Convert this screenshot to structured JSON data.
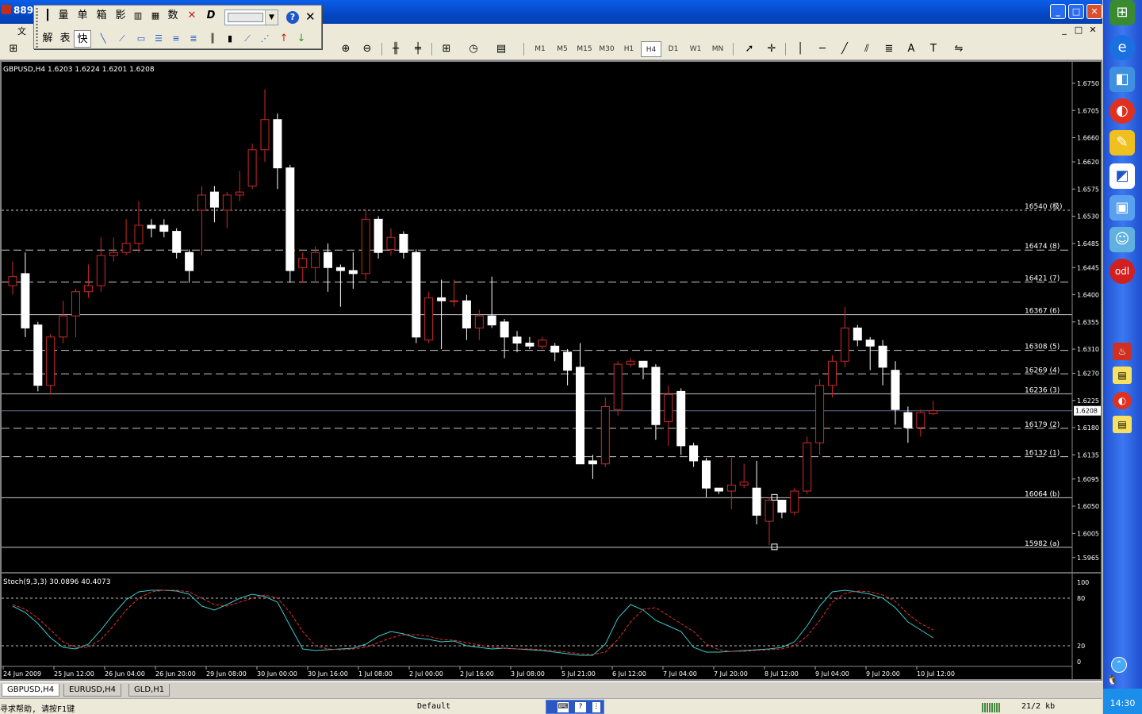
{
  "window": {
    "title": "889",
    "btn_min": "_",
    "btn_max": "□",
    "btn_close": "✕"
  },
  "menubar": {
    "items": [
      "文"
    ],
    "mdi_min": "_",
    "mdi_max": "□",
    "mdi_close": "✕"
  },
  "floatbar": {
    "row1": [
      "量",
      "单",
      "箱",
      "影",
      "数"
    ],
    "row2": [
      "解",
      "表",
      "快"
    ],
    "help": "?",
    "close": "✕"
  },
  "timeframes": [
    "M1",
    "M5",
    "M15",
    "M30",
    "H1",
    "H4",
    "D1",
    "W1",
    "MN"
  ],
  "active_timeframe": "H4",
  "toolbar_text_tool": "A",
  "chart": {
    "header": "GBPUSD,H4  1.6203 1.6224 1.6201 1.6208",
    "current_price": "1.6208",
    "indicator_label": "Stoch(9,3,3) 30.0896 40.4073",
    "osc_ticks": [
      "100",
      "80",
      "20",
      "0"
    ]
  },
  "chart_data": {
    "type": "candlestick",
    "title": "GBPUSD,H4  1.6203 1.6224 1.6201 1.6208",
    "y_ticks": [
      1.675,
      1.6705,
      1.666,
      1.662,
      1.6575,
      1.653,
      1.6485,
      1.6445,
      1.64,
      1.6355,
      1.631,
      1.627,
      1.6225,
      1.618,
      1.6135,
      1.6095,
      1.605,
      1.6005,
      1.5965
    ],
    "ylim": [
      1.5945,
      1.6775
    ],
    "x_ticks": [
      "24 Jun 2009",
      "25 Jun 12:00",
      "26 Jun 04:00",
      "26 Jun 20:00",
      "29 Jun 08:00",
      "30 Jun 00:00",
      "30 Jun 16:00",
      "1 Jul 08:00",
      "2 Jul 00:00",
      "2 Jul 16:00",
      "3 Jul 08:00",
      "5 Jul 21:00",
      "6 Jul 12:00",
      "7 Jul 04:00",
      "7 Jul 20:00",
      "8 Jul 12:00",
      "9 Jul 04:00",
      "9 Jul 20:00",
      "10 Jul 12:00"
    ],
    "levels": [
      {
        "label": "16540 (极)",
        "value": 1.654,
        "style": "dotted"
      },
      {
        "label": "16474 (8)",
        "value": 1.6474,
        "style": "dashed"
      },
      {
        "label": "16421 (7)",
        "value": 1.6421,
        "style": "dashed"
      },
      {
        "label": "16367 (6)",
        "value": 1.6367,
        "style": "solid"
      },
      {
        "label": "16308 (5)",
        "value": 1.6308,
        "style": "dashed"
      },
      {
        "label": "16269 (4)",
        "value": 1.6269,
        "style": "dashed"
      },
      {
        "label": "16236 (3)",
        "value": 1.6236,
        "style": "solid"
      },
      {
        "label": "16179 (2)",
        "value": 1.6179,
        "style": "dashed"
      },
      {
        "label": "16132 (1)",
        "value": 1.6132,
        "style": "dashed"
      },
      {
        "label": "16064 (b)",
        "value": 1.6064,
        "style": "solid"
      },
      {
        "label": "15982 (a)",
        "value": 1.5982,
        "style": "solid"
      }
    ],
    "candles": [
      {
        "o": 1.6415,
        "h": 1.6455,
        "l": 1.64,
        "c": 1.643
      },
      {
        "o": 1.6435,
        "h": 1.647,
        "l": 1.633,
        "c": 1.6345
      },
      {
        "o": 1.635,
        "h": 1.6355,
        "l": 1.624,
        "c": 1.625
      },
      {
        "o": 1.625,
        "h": 1.6335,
        "l": 1.6235,
        "c": 1.633
      },
      {
        "o": 1.633,
        "h": 1.639,
        "l": 1.632,
        "c": 1.6365
      },
      {
        "o": 1.6365,
        "h": 1.641,
        "l": 1.633,
        "c": 1.6405
      },
      {
        "o": 1.6405,
        "h": 1.645,
        "l": 1.6395,
        "c": 1.6415
      },
      {
        "o": 1.6415,
        "h": 1.6495,
        "l": 1.6405,
        "c": 1.6465
      },
      {
        "o": 1.6465,
        "h": 1.6495,
        "l": 1.6455,
        "c": 1.647
      },
      {
        "o": 1.647,
        "h": 1.6525,
        "l": 1.6465,
        "c": 1.6485
      },
      {
        "o": 1.6485,
        "h": 1.6555,
        "l": 1.647,
        "c": 1.6515
      },
      {
        "o": 1.6515,
        "h": 1.6525,
        "l": 1.6495,
        "c": 1.651
      },
      {
        "o": 1.6515,
        "h": 1.6525,
        "l": 1.6495,
        "c": 1.6505
      },
      {
        "o": 1.6505,
        "h": 1.651,
        "l": 1.646,
        "c": 1.647
      },
      {
        "o": 1.647,
        "h": 1.6475,
        "l": 1.642,
        "c": 1.644
      },
      {
        "o": 1.654,
        "h": 1.658,
        "l": 1.6465,
        "c": 1.6565
      },
      {
        "o": 1.657,
        "h": 1.658,
        "l": 1.652,
        "c": 1.6545
      },
      {
        "o": 1.654,
        "h": 1.657,
        "l": 1.651,
        "c": 1.6565
      },
      {
        "o": 1.6565,
        "h": 1.6605,
        "l": 1.6555,
        "c": 1.657
      },
      {
        "o": 1.658,
        "h": 1.665,
        "l": 1.6575,
        "c": 1.664
      },
      {
        "o": 1.664,
        "h": 1.674,
        "l": 1.662,
        "c": 1.669
      },
      {
        "o": 1.669,
        "h": 1.67,
        "l": 1.6575,
        "c": 1.661
      },
      {
        "o": 1.661,
        "h": 1.6615,
        "l": 1.642,
        "c": 1.644
      },
      {
        "o": 1.6445,
        "h": 1.647,
        "l": 1.642,
        "c": 1.646
      },
      {
        "o": 1.6445,
        "h": 1.648,
        "l": 1.642,
        "c": 1.647
      },
      {
        "o": 1.647,
        "h": 1.6485,
        "l": 1.6405,
        "c": 1.6445
      },
      {
        "o": 1.6445,
        "h": 1.645,
        "l": 1.638,
        "c": 1.644
      },
      {
        "o": 1.644,
        "h": 1.647,
        "l": 1.641,
        "c": 1.6435
      },
      {
        "o": 1.6435,
        "h": 1.654,
        "l": 1.6425,
        "c": 1.6525
      },
      {
        "o": 1.6525,
        "h": 1.653,
        "l": 1.646,
        "c": 1.647
      },
      {
        "o": 1.6475,
        "h": 1.651,
        "l": 1.6465,
        "c": 1.6495
      },
      {
        "o": 1.65,
        "h": 1.6505,
        "l": 1.646,
        "c": 1.647
      },
      {
        "o": 1.647,
        "h": 1.6475,
        "l": 1.632,
        "c": 1.633
      },
      {
        "o": 1.6325,
        "h": 1.6405,
        "l": 1.632,
        "c": 1.6395
      },
      {
        "o": 1.6395,
        "h": 1.6425,
        "l": 1.631,
        "c": 1.639
      },
      {
        "o": 1.639,
        "h": 1.6425,
        "l": 1.638,
        "c": 1.639
      },
      {
        "o": 1.639,
        "h": 1.64,
        "l": 1.6325,
        "c": 1.6345
      },
      {
        "o": 1.6345,
        "h": 1.6375,
        "l": 1.6325,
        "c": 1.6365
      },
      {
        "o": 1.6365,
        "h": 1.643,
        "l": 1.6345,
        "c": 1.635
      },
      {
        "o": 1.6355,
        "h": 1.636,
        "l": 1.6295,
        "c": 1.633
      },
      {
        "o": 1.633,
        "h": 1.634,
        "l": 1.6305,
        "c": 1.632
      },
      {
        "o": 1.632,
        "h": 1.633,
        "l": 1.631,
        "c": 1.6315
      },
      {
        "o": 1.6315,
        "h": 1.633,
        "l": 1.631,
        "c": 1.6325
      },
      {
        "o": 1.6315,
        "h": 1.632,
        "l": 1.629,
        "c": 1.6305
      },
      {
        "o": 1.6305,
        "h": 1.631,
        "l": 1.625,
        "c": 1.6275
      },
      {
        "o": 1.628,
        "h": 1.632,
        "l": 1.627,
        "c": 1.612
      },
      {
        "o": 1.6125,
        "h": 1.6135,
        "l": 1.6095,
        "c": 1.612
      },
      {
        "o": 1.612,
        "h": 1.623,
        "l": 1.6115,
        "c": 1.6215
      },
      {
        "o": 1.621,
        "h": 1.629,
        "l": 1.62,
        "c": 1.6285
      },
      {
        "o": 1.6285,
        "h": 1.6295,
        "l": 1.628,
        "c": 1.629
      },
      {
        "o": 1.629,
        "h": 1.629,
        "l": 1.626,
        "c": 1.628
      },
      {
        "o": 1.628,
        "h": 1.6285,
        "l": 1.616,
        "c": 1.6185
      },
      {
        "o": 1.619,
        "h": 1.625,
        "l": 1.615,
        "c": 1.6235
      },
      {
        "o": 1.624,
        "h": 1.6245,
        "l": 1.6135,
        "c": 1.615
      },
      {
        "o": 1.615,
        "h": 1.6155,
        "l": 1.6115,
        "c": 1.6125
      },
      {
        "o": 1.6125,
        "h": 1.613,
        "l": 1.6065,
        "c": 1.608
      },
      {
        "o": 1.608,
        "h": 1.608,
        "l": 1.607,
        "c": 1.6075
      },
      {
        "o": 1.6075,
        "h": 1.613,
        "l": 1.6045,
        "c": 1.6085
      },
      {
        "o": 1.6085,
        "h": 1.612,
        "l": 1.608,
        "c": 1.609
      },
      {
        "o": 1.608,
        "h": 1.6125,
        "l": 1.602,
        "c": 1.6035
      },
      {
        "o": 1.6025,
        "h": 1.6065,
        "l": 1.5985,
        "c": 1.606
      },
      {
        "o": 1.606,
        "h": 1.606,
        "l": 1.603,
        "c": 1.604
      },
      {
        "o": 1.604,
        "h": 1.608,
        "l": 1.6035,
        "c": 1.6075
      },
      {
        "o": 1.6075,
        "h": 1.6165,
        "l": 1.607,
        "c": 1.6155
      },
      {
        "o": 1.6155,
        "h": 1.626,
        "l": 1.6135,
        "c": 1.625
      },
      {
        "o": 1.625,
        "h": 1.63,
        "l": 1.623,
        "c": 1.629
      },
      {
        "o": 1.629,
        "h": 1.638,
        "l": 1.628,
        "c": 1.6345
      },
      {
        "o": 1.6345,
        "h": 1.635,
        "l": 1.6315,
        "c": 1.6325
      },
      {
        "o": 1.6325,
        "h": 1.633,
        "l": 1.6275,
        "c": 1.6315
      },
      {
        "o": 1.6315,
        "h": 1.6325,
        "l": 1.625,
        "c": 1.628
      },
      {
        "o": 1.6275,
        "h": 1.629,
        "l": 1.6185,
        "c": 1.621
      },
      {
        "o": 1.6205,
        "h": 1.6215,
        "l": 1.6155,
        "c": 1.618
      },
      {
        "o": 1.618,
        "h": 1.621,
        "l": 1.6165,
        "c": 1.6205
      },
      {
        "o": 1.6203,
        "h": 1.6224,
        "l": 1.6201,
        "c": 1.6208
      }
    ],
    "stoch_main": [
      70,
      62,
      48,
      30,
      18,
      16,
      22,
      40,
      60,
      78,
      88,
      90,
      90,
      89,
      85,
      70,
      65,
      72,
      80,
      85,
      82,
      75,
      45,
      16,
      14,
      15,
      16,
      17,
      22,
      32,
      38,
      35,
      30,
      28,
      25,
      26,
      20,
      18,
      16,
      17,
      16,
      15,
      14,
      12,
      10,
      8,
      8,
      22,
      55,
      72,
      65,
      52,
      45,
      38,
      18,
      12,
      12,
      13,
      14,
      15,
      16,
      18,
      25,
      45,
      70,
      88,
      90,
      88,
      85,
      80,
      68,
      50,
      40,
      30
    ],
    "stoch_signal": [
      72,
      66,
      55,
      40,
      25,
      18,
      18,
      28,
      45,
      65,
      80,
      88,
      90,
      90,
      88,
      80,
      72,
      70,
      75,
      80,
      84,
      80,
      62,
      38,
      20,
      16,
      15,
      16,
      18,
      24,
      30,
      34,
      34,
      32,
      28,
      27,
      24,
      21,
      18,
      17,
      16,
      16,
      15,
      14,
      12,
      10,
      9,
      12,
      28,
      50,
      66,
      68,
      58,
      48,
      38,
      22,
      15,
      13,
      13,
      14,
      15,
      16,
      20,
      32,
      52,
      75,
      86,
      89,
      88,
      84,
      76,
      60,
      48,
      40
    ],
    "stoch_levels": [
      100,
      80,
      20,
      0
    ]
  },
  "tabs": [
    "GBPUSD,H4",
    "EURUSD,H4",
    "GLD,H1"
  ],
  "active_tab": "GBPUSD,H4",
  "status": {
    "help": "寻求帮助, 请按F1键",
    "profile": "Default",
    "traffic": "21/2 kb"
  },
  "quickbar": {
    "clock": "14:30"
  },
  "colors": {
    "bull": "#cc2a2a",
    "bear_fill": "#ffffff",
    "stoch_main": "#40c8c8",
    "stoch_signal": "#e03030",
    "level_line": "#c8c8c8"
  }
}
